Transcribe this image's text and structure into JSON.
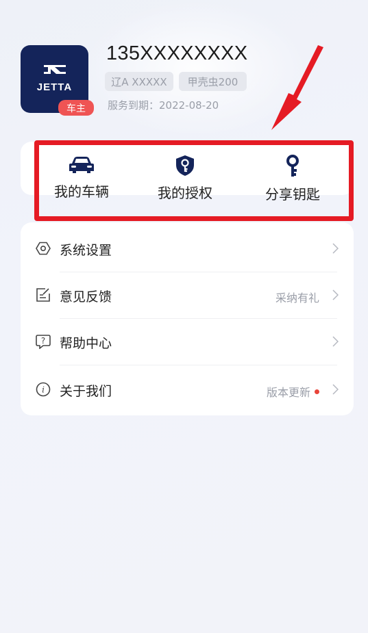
{
  "profile": {
    "logo_text": "JETTA",
    "owner_badge": "车主",
    "phone": "135XXXXXXXX",
    "plate": "辽A XXXXX",
    "model": "甲壳虫200",
    "expire": "服务到期：2022-08-20"
  },
  "quick_actions": [
    {
      "label": "我的车辆",
      "icon": "car-icon"
    },
    {
      "label": "我的授权",
      "icon": "shield-key-icon"
    },
    {
      "label": "分享钥匙",
      "icon": "key-icon"
    }
  ],
  "menu": [
    {
      "label": "系统设置",
      "icon": "settings-icon",
      "right": ""
    },
    {
      "label": "意见反馈",
      "icon": "feedback-icon",
      "right": "采纳有礼"
    },
    {
      "label": "帮助中心",
      "icon": "help-icon",
      "right": ""
    },
    {
      "label": "关于我们",
      "icon": "info-icon",
      "right": "版本更新"
    }
  ],
  "colors": {
    "brand": "#14245a",
    "badge": "#ef5454",
    "annotation": "#e51b24",
    "update_dot": "#e8443a"
  }
}
